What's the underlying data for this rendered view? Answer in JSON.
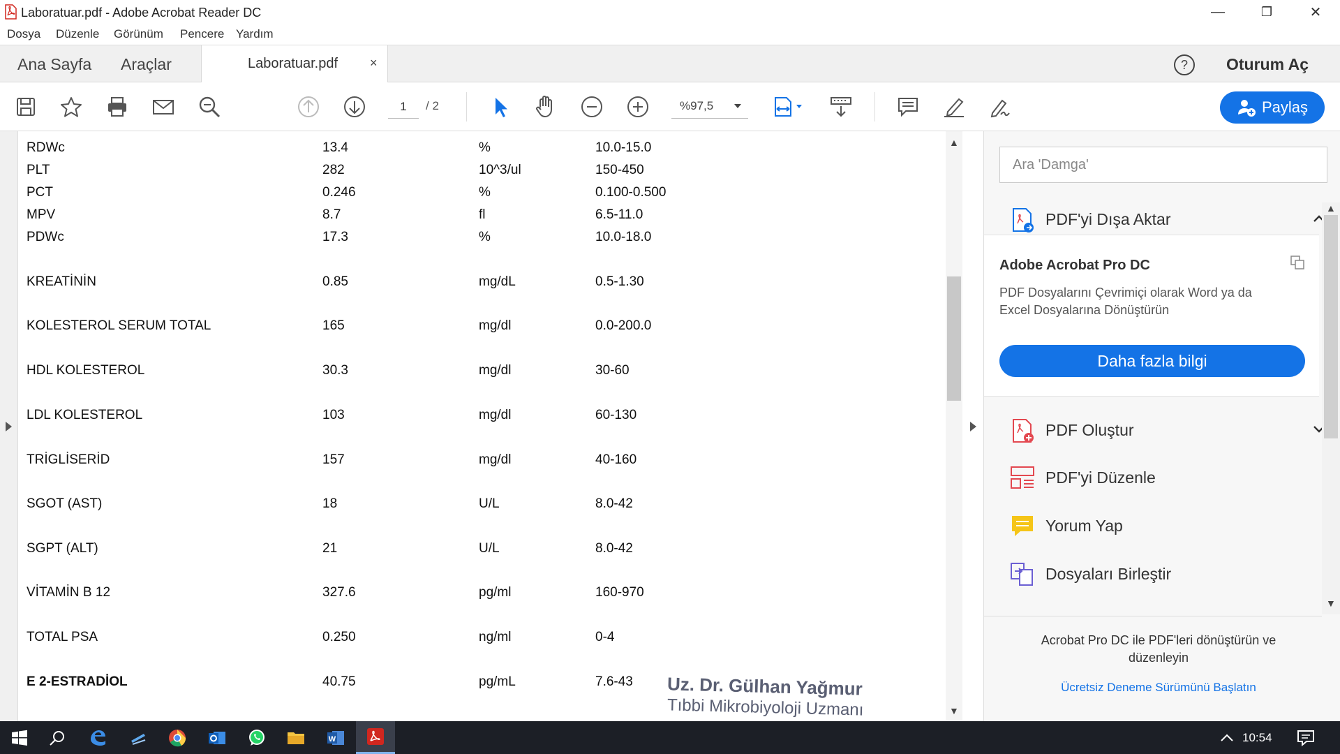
{
  "window": {
    "title": "Laboratuar.pdf - Adobe Acrobat Reader DC",
    "minimize": "—",
    "restore": "❐",
    "close": "✕"
  },
  "menu": [
    "Dosya",
    "Düzenle",
    "Görünüm",
    "Pencere",
    "Yardım"
  ],
  "tabs": {
    "home": "Ana Sayfa",
    "tools": "Araçlar",
    "document": "Laboratuar.pdf",
    "close_tab": "×",
    "sign_in": "Oturum Aç",
    "help_glyph": "?"
  },
  "toolbar": {
    "page_current": "1",
    "page_total": "/  2",
    "zoom": "%97,5",
    "share": "Paylaş",
    "icons": [
      "save-icon",
      "star-icon",
      "print-icon",
      "mail-icon",
      "search-icon",
      "page-up-icon",
      "page-down-icon",
      "select-cursor-icon",
      "hand-icon",
      "zoom-out-icon",
      "zoom-in-icon",
      "fit-page-icon",
      "scroll-mode-icon",
      "comment-icon",
      "highlight-pen-icon",
      "sign-icon"
    ]
  },
  "document": {
    "rows": [
      {
        "name": "RDWc",
        "value": "13.4",
        "unit": "%",
        "range": "10.0-15.0"
      },
      {
        "name": "PLT",
        "value": "282",
        "unit": "10^3/ul",
        "range": "150-450"
      },
      {
        "name": "PCT",
        "value": "0.246",
        "unit": "%",
        "range": "0.100-0.500"
      },
      {
        "name": "MPV",
        "value": "8.7",
        "unit": "fl",
        "range": "6.5-11.0"
      },
      {
        "name": "PDWc",
        "value": "17.3",
        "unit": "%",
        "range": "10.0-18.0"
      },
      {
        "name": "KREATİNİN",
        "value": "0.85",
        "unit": "mg/dL",
        "range": "0.5-1.30"
      },
      {
        "name": "KOLESTEROL SERUM TOTAL",
        "value": "165",
        "unit": "mg/dl",
        "range": "0.0-200.0"
      },
      {
        "name": "HDL KOLESTEROL",
        "value": "30.3",
        "unit": "mg/dl",
        "range": "30-60"
      },
      {
        "name": "LDL KOLESTEROL",
        "value": "103",
        "unit": "mg/dl",
        "range": "60-130"
      },
      {
        "name": "TRİGLİSERİD",
        "value": "157",
        "unit": "mg/dl",
        "range": "40-160"
      },
      {
        "name": "SGOT (AST)",
        "value": "18",
        "unit": "U/L",
        "range": "8.0-42"
      },
      {
        "name": "SGPT (ALT)",
        "value": "21",
        "unit": "U/L",
        "range": "8.0-42"
      },
      {
        "name": "VİTAMİN B 12",
        "value": "327.6",
        "unit": "pg/ml",
        "range": "160-970"
      },
      {
        "name": "TOTAL PSA",
        "value": "0.250",
        "unit": "ng/ml",
        "range": "0-4"
      },
      {
        "name": "E 2-ESTRADİOL",
        "value": "40.75",
        "unit": "pg/mL",
        "range": "7.6-43"
      }
    ],
    "stamp_line1": "Uz. Dr. Gülhan Yağmur",
    "stamp_line2": "Tıbbi Mikrobiyoloji Uzmanı"
  },
  "right_panel": {
    "search_placeholder": "Ara 'Damga'",
    "export_pdf": "PDF'yi Dışa Aktar",
    "promo_title": "Adobe Acrobat Pro DC",
    "promo_desc": "PDF Dosyalarını Çevrimiçi olarak Word ya da Excel Dosyalarına Dönüştürün",
    "promo_button": "Daha fazla bilgi",
    "tools": [
      "PDF Oluştur",
      "PDF'yi Düzenle",
      "Yorum Yap",
      "Dosyaları Birleştir"
    ],
    "footer_text": "Acrobat Pro DC ile PDF'leri dönüştürün ve düzenleyin",
    "footer_link": "Ücretsiz Deneme Sürümünü Başlatın"
  },
  "taskbar": {
    "apps": [
      "windows-start-icon",
      "search-icon",
      "edge-icon",
      "files-icon",
      "chrome-icon",
      "outlook-icon",
      "whatsapp-icon",
      "file-explorer-icon",
      "word-icon",
      "acrobat-icon"
    ],
    "clock": "10:54"
  },
  "colors": {
    "accent": "#1473e6",
    "taskbar": "#1c1f26"
  }
}
